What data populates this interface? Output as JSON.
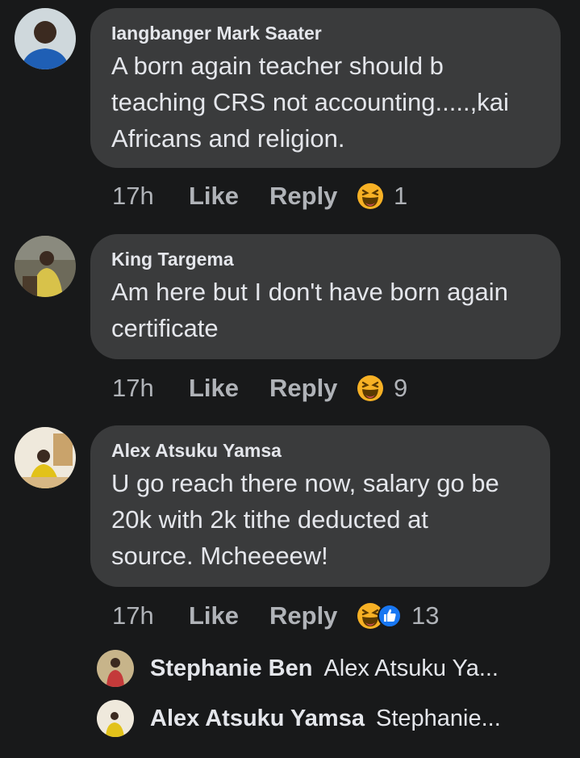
{
  "comments": [
    {
      "author": "Iangbanger Mark Saater",
      "text": "A born again teacher should b\nteaching CRS not accounting.....,kai\nAfricans and religion.",
      "time": "17h",
      "like_label": "Like",
      "reply_label": "Reply",
      "reaction_icons": [
        "haha-icon"
      ],
      "reaction_count": "1"
    },
    {
      "author": "King Targema",
      "text": "Am here but I don't have born again\ncertificate",
      "time": "17h",
      "like_label": "Like",
      "reply_label": "Reply",
      "reaction_icons": [
        "haha-icon"
      ],
      "reaction_count": "9"
    },
    {
      "author": "Alex Atsuku Yamsa",
      "text": "U go reach there now, salary go be\n20k with 2k tithe deducted at\nsource. Mcheeeew!",
      "time": "17h",
      "like_label": "Like",
      "reply_label": "Reply",
      "reaction_icons": [
        "haha-icon",
        "like-icon"
      ],
      "reaction_count": "13"
    }
  ],
  "replies": [
    {
      "name": "Stephanie Ben",
      "preview": "Alex Atsuku Ya..."
    },
    {
      "name": "Alex Atsuku Yamsa",
      "preview": "Stephanie..."
    }
  ],
  "colors": {
    "background": "#18191a",
    "bubble": "#3a3b3c",
    "text": "#e4e6eb",
    "secondary": "#b0b3b8",
    "haha": "#f7b125",
    "like_blue": "#1877f2"
  }
}
